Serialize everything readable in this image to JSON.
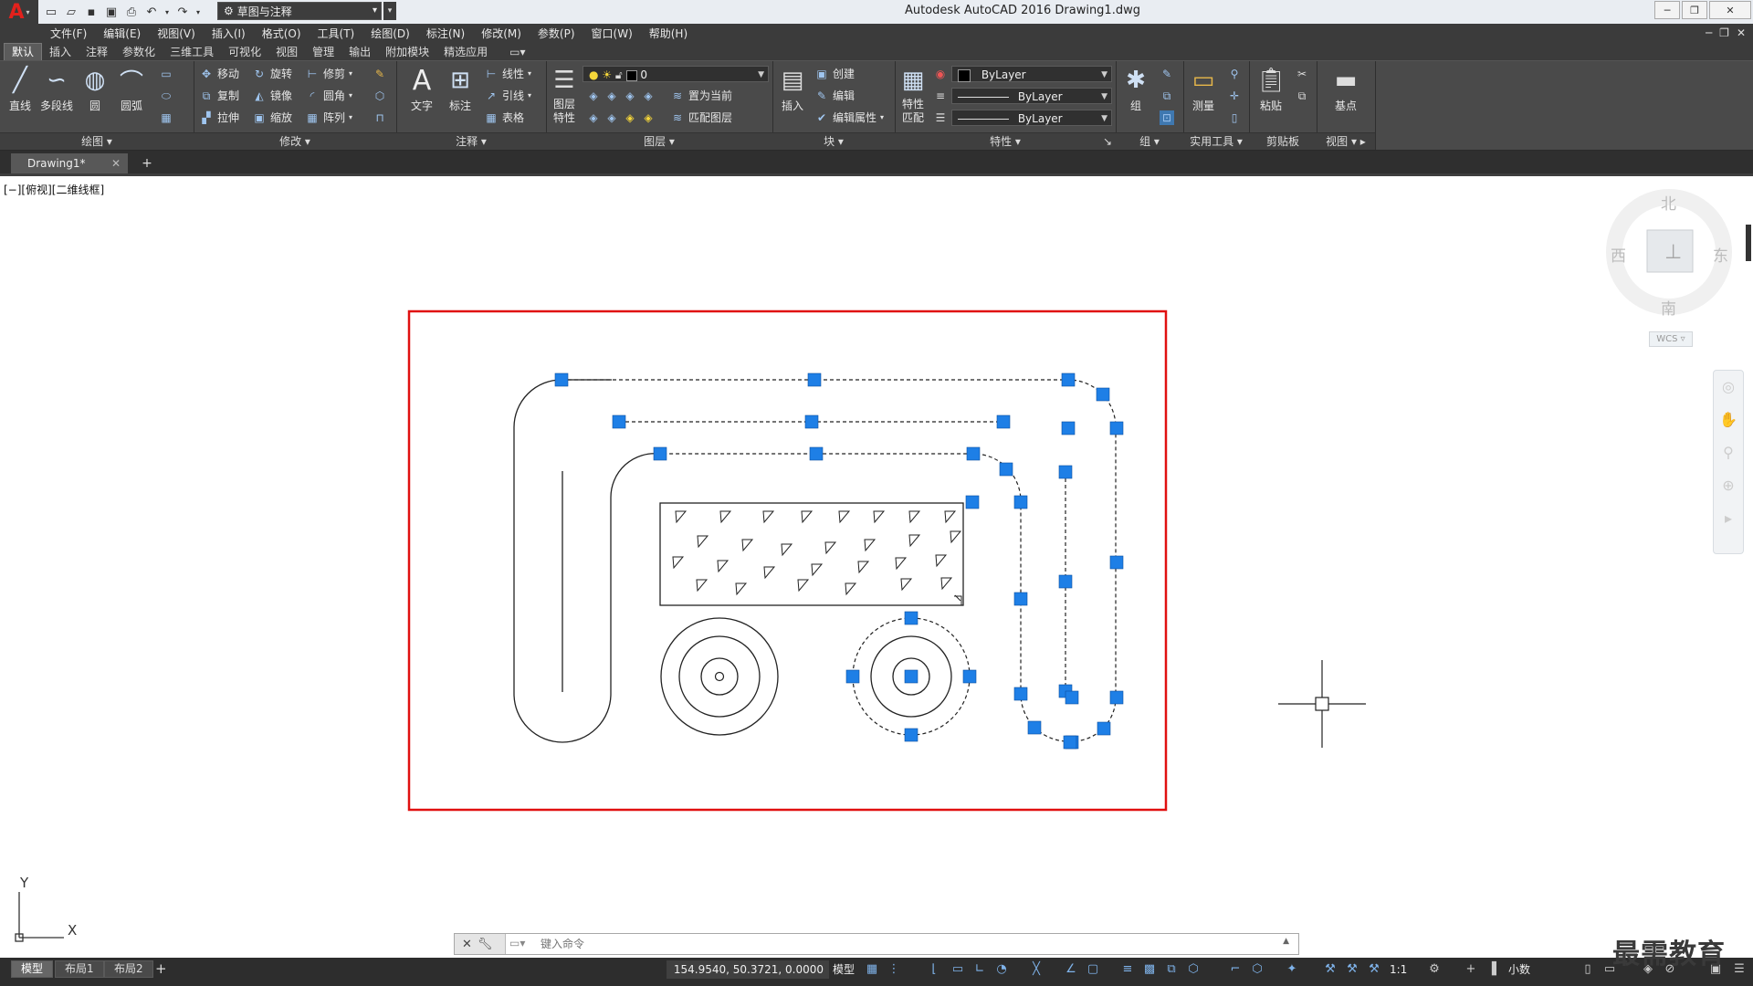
{
  "app": {
    "title": "Autodesk AutoCAD 2016    Drawing1.dwg",
    "workspace": "草图与注释",
    "logo_letter": "A"
  },
  "menus": [
    "文件(F)",
    "编辑(E)",
    "视图(V)",
    "插入(I)",
    "格式(O)",
    "工具(T)",
    "绘图(D)",
    "标注(N)",
    "修改(M)",
    "参数(P)",
    "窗口(W)",
    "帮助(H)"
  ],
  "ribbon_tabs": [
    "默认",
    "插入",
    "注释",
    "参数化",
    "三维工具",
    "可视化",
    "视图",
    "管理",
    "输出",
    "附加模块",
    "精选应用"
  ],
  "ribbon": {
    "draw": {
      "title": "绘图",
      "line": "直线",
      "polyline": "多段线",
      "circle": "圆",
      "arc": "圆弧"
    },
    "modify": {
      "title": "修改",
      "move": "移动",
      "rotate": "旋转",
      "trim": "修剪",
      "copy": "复制",
      "mirror": "镜像",
      "fillet": "圆角",
      "stretch": "拉伸",
      "scale": "缩放",
      "array": "阵列"
    },
    "annotation": {
      "title": "注释",
      "text": "文字",
      "dimension": "标注",
      "linear": "线性",
      "leader": "引线",
      "table": "表格"
    },
    "layers": {
      "title": "图层",
      "props": "图层\n特性",
      "layer_name": "0",
      "set_current": "置为当前",
      "match": "匹配图层"
    },
    "block": {
      "title": "块",
      "insert": "插入",
      "create": "创建",
      "edit": "编辑",
      "edit_attr": "编辑属性"
    },
    "properties": {
      "title": "特性",
      "match": "特性\n匹配",
      "color": "ByLayer",
      "linetype": "ByLayer",
      "lineweight": "ByLayer"
    },
    "groups": {
      "title": "组",
      "group": "组"
    },
    "utilities": {
      "title": "实用工具",
      "measure": "测量"
    },
    "clipboard": {
      "title": "剪贴板",
      "paste": "粘贴"
    },
    "view": {
      "title": "视图",
      "base": "基点"
    }
  },
  "file_tab": {
    "name": "Drawing1*"
  },
  "view_label": "[−][俯视][二维线框]",
  "viewcube": {
    "north": "北",
    "south": "南",
    "east": "东",
    "west": "西",
    "wcs": "WCS"
  },
  "ucs": {
    "x": "X",
    "y": "Y"
  },
  "command": {
    "placeholder": "键入命令"
  },
  "layout_tabs": [
    "模型",
    "布局1",
    "布局2"
  ],
  "status": {
    "coords": "154.9540, 50.3721, 0.0000",
    "model": "模型",
    "scale": "1:1",
    "units": "小数"
  },
  "watermark": "最需教育"
}
